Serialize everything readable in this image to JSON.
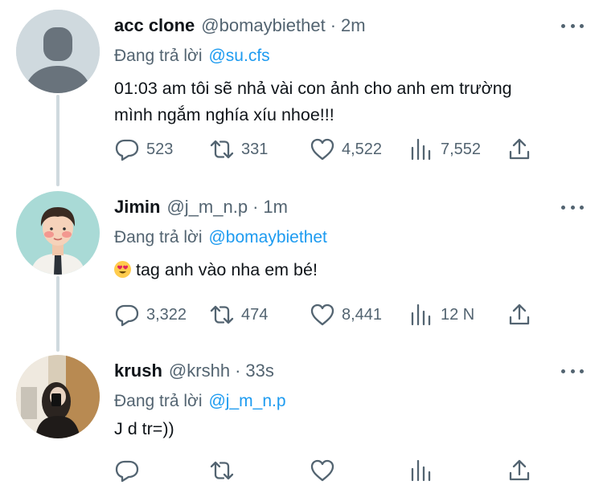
{
  "tweets": [
    {
      "name": "acc clone",
      "handle": "@bomaybiethet",
      "time": "2m",
      "reply_prefix": "Đang trả lời",
      "reply_to": "@su.cfs",
      "text_line1": "01:03 am tôi sẽ nhả vài con ảnh cho anh em trường",
      "text_line2": "mình ngắm nghía xíu nhoe!!!",
      "replies": "523",
      "retweets": "331",
      "likes": "4,522",
      "views": "7,552"
    },
    {
      "name": "Jimin",
      "handle": "@j_m_n.p",
      "time": "1m",
      "reply_prefix": "Đang trả lời",
      "reply_to": "@bomaybiethet",
      "text_line1": "tag anh vào nha em bé!",
      "emoji": "heart-eyes-emoji",
      "replies": "3,322",
      "retweets": "474",
      "likes": "8,441",
      "views": "12 N"
    },
    {
      "name": "krush",
      "handle": "@krshh",
      "time": "33s",
      "reply_prefix": "Đang trả lời",
      "reply_to": "@j_m_n.p",
      "text_line1": "J d tr=))",
      "replies": "",
      "retweets": "",
      "likes": "",
      "views": ""
    }
  ],
  "separator": "·",
  "icons": {
    "reply": "reply-icon",
    "retweet": "retweet-icon",
    "like": "heart-icon",
    "views": "views-icon",
    "share": "share-icon",
    "more": "more-icon"
  },
  "colors": {
    "text": "#0f1419",
    "secondary": "#536471",
    "link": "#1d9bf0",
    "thread_line": "#cfd9de"
  }
}
